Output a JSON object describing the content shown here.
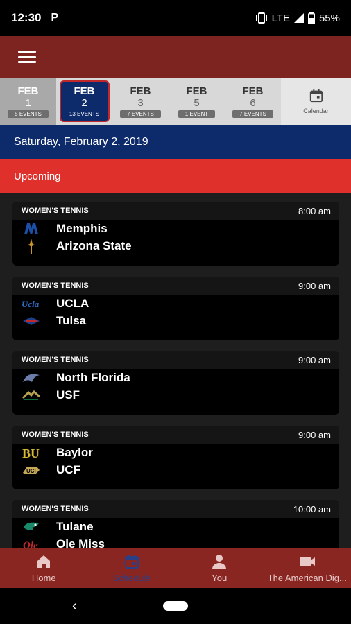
{
  "status": {
    "time": "12:30",
    "p": "P",
    "lte": "LTE",
    "battery": "55%"
  },
  "dates": [
    {
      "month": "FEB",
      "day": "1",
      "events": "5 EVENTS",
      "state": "past"
    },
    {
      "month": "FEB",
      "day": "2",
      "events": "13 EVENTS",
      "state": "selected"
    },
    {
      "month": "FEB",
      "day": "3",
      "events": "7 EVENTS",
      "state": ""
    },
    {
      "month": "FEB",
      "day": "5",
      "events": "1 EVENT",
      "state": ""
    },
    {
      "month": "FEB",
      "day": "6",
      "events": "7 EVENTS",
      "state": ""
    }
  ],
  "calendar_label": "Calendar",
  "date_header": "Saturday, February 2, 2019",
  "section_label": "Upcoming",
  "games": [
    {
      "sport": "WOMEN'S TENNIS",
      "time": "8:00 am",
      "team1": "Memphis",
      "team2": "Arizona State"
    },
    {
      "sport": "WOMEN'S TENNIS",
      "time": "9:00 am",
      "team1": "UCLA",
      "team2": "Tulsa"
    },
    {
      "sport": "WOMEN'S TENNIS",
      "time": "9:00 am",
      "team1": "North Florida",
      "team2": "USF"
    },
    {
      "sport": "WOMEN'S TENNIS",
      "time": "9:00 am",
      "team1": "Baylor",
      "team2": "UCF"
    },
    {
      "sport": "WOMEN'S TENNIS",
      "time": "10:00 am",
      "team1": "Tulane",
      "team2": "Ole Miss"
    }
  ],
  "nav": {
    "home": "Home",
    "schedule": "Schedule",
    "you": "You",
    "digital": "The American Dig..."
  },
  "colors": {
    "app_bar": "#7d2320",
    "navy": "#0d2a6b",
    "red": "#e0302c"
  }
}
